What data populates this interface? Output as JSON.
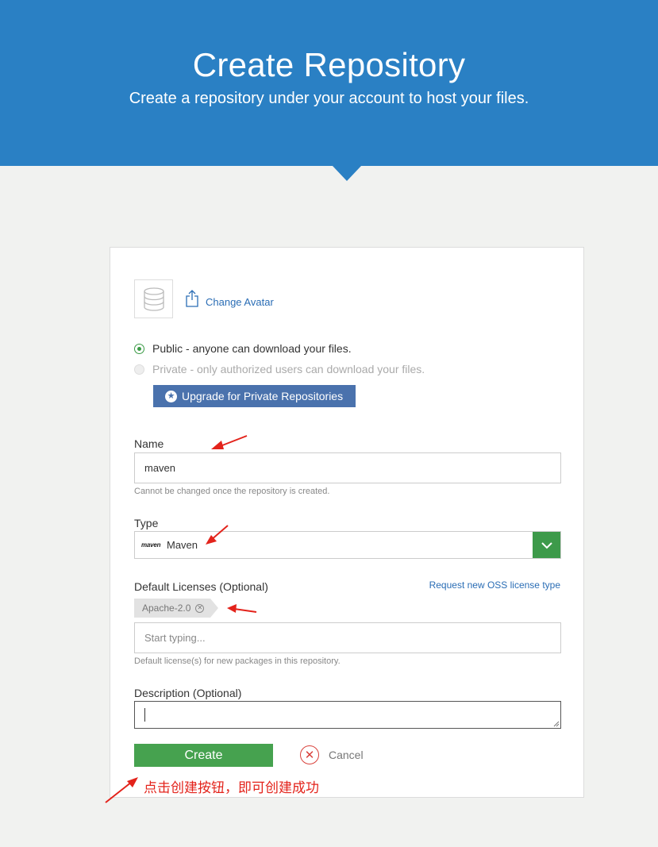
{
  "header": {
    "title": "Create Repository",
    "subtitle": "Create a repository under your account to host your files."
  },
  "avatar": {
    "icon": "database-icon",
    "change_label": "Change Avatar"
  },
  "visibility": {
    "public_label": "Public - anyone can download your files.",
    "private_label": "Private - only authorized users can download your files.",
    "selected": "public",
    "upgrade_label": "Upgrade for Private Repositories"
  },
  "name_field": {
    "label": "Name",
    "value": "maven",
    "help": "Cannot be changed once the repository is created."
  },
  "type_field": {
    "label": "Type",
    "logo_text": "maven",
    "value": "Maven"
  },
  "licenses": {
    "label": "Default Licenses (Optional)",
    "request_link": "Request new OSS license type",
    "tags": [
      "Apache-2.0"
    ],
    "placeholder": "Start typing...",
    "help": "Default license(s) for new packages in this repository."
  },
  "description": {
    "label": "Description (Optional)",
    "value": ""
  },
  "actions": {
    "create_label": "Create",
    "cancel_label": "Cancel"
  },
  "annotation": {
    "text": "点击创建按钮，即可创建成功",
    "color": "#e3231b"
  },
  "colors": {
    "brand_blue": "#2a80c4",
    "success_green": "#46a24f",
    "upgrade_blue": "#4a72ad",
    "danger_red": "#d9413b"
  }
}
